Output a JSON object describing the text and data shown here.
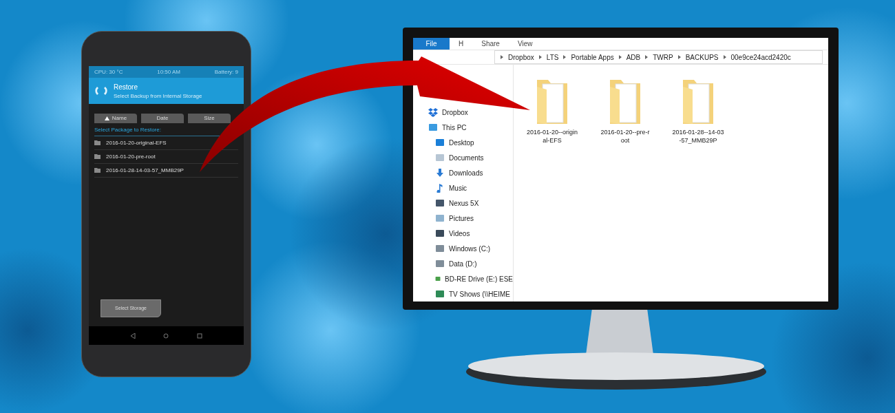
{
  "phone": {
    "status_bar": [
      "CPU: 30 °C",
      "10:50 AM",
      "Battery: 9"
    ],
    "header": {
      "title": "Restore",
      "subtitle": "Select Backup from Internal Storage"
    },
    "sort_buttons": [
      {
        "label": "Name",
        "sorted": true
      },
      {
        "label": "Date",
        "sorted": false
      },
      {
        "label": "Size",
        "sorted": false
      }
    ],
    "section_label": "Select Package to Restore:",
    "packages": [
      "2016-01-20-original-EFS",
      "2016-01-20-pre-root",
      "2016-01-28-14-03-57_MMB29P"
    ],
    "storage_button": "Select Storage"
  },
  "explorer": {
    "ribbon_tabs": [
      {
        "label": "File",
        "selected": true
      },
      {
        "label": "H",
        "selected": false
      },
      {
        "label": "Share",
        "selected": false
      },
      {
        "label": "View",
        "selected": false
      }
    ],
    "breadcrumb": [
      "Dropbox",
      "LTS",
      "Portable Apps",
      "ADB",
      "TWRP",
      "BACKUPS",
      "00e9ce24acd2420c"
    ],
    "nav_items": [
      {
        "label": "Dropbox",
        "kind": "dropbox"
      },
      {
        "label": "This PC",
        "kind": "pc",
        "children": [
          {
            "label": "Desktop",
            "kind": "desktop"
          },
          {
            "label": "Documents",
            "kind": "documents"
          },
          {
            "label": "Downloads",
            "kind": "downloads"
          },
          {
            "label": "Music",
            "kind": "music"
          },
          {
            "label": "Nexus 5X",
            "kind": "phone"
          },
          {
            "label": "Pictures",
            "kind": "pictures"
          },
          {
            "label": "Videos",
            "kind": "videos"
          },
          {
            "label": "Windows (C:)",
            "kind": "drive"
          },
          {
            "label": "Data (D:)",
            "kind": "drive"
          },
          {
            "label": "BD-RE Drive (E:) ESE",
            "kind": "disc"
          },
          {
            "label": "TV Shows (\\\\HEIME",
            "kind": "network"
          }
        ]
      }
    ],
    "folders": [
      "2016-01-20--original-EFS",
      "2016-01-20--pre-root",
      "2016-01-28--14-03-57_MMB29P"
    ]
  }
}
